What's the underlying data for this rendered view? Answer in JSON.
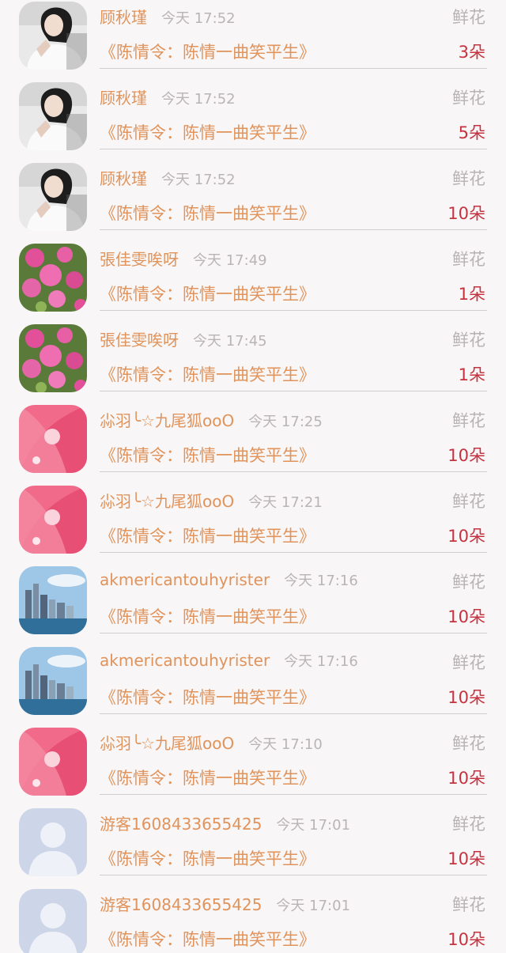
{
  "records": [
    {
      "name": "顾秋瑾",
      "time": "今天 17:52",
      "gift": "鲜花",
      "book": "《陈情令：陈情一曲笑平生》",
      "count": "3朵",
      "avatar": "portrait-girl"
    },
    {
      "name": "顾秋瑾",
      "time": "今天 17:52",
      "gift": "鲜花",
      "book": "《陈情令：陈情一曲笑平生》",
      "count": "5朵",
      "avatar": "portrait-girl"
    },
    {
      "name": "顾秋瑾",
      "time": "今天 17:52",
      "gift": "鲜花",
      "book": "《陈情令：陈情一曲笑平生》",
      "count": "10朵",
      "avatar": "portrait-girl"
    },
    {
      "name": "張佳雯唉呀",
      "time": "今天 17:49",
      "gift": "鲜花",
      "book": "《陈情令：陈情一曲笑平生》",
      "count": "1朵",
      "avatar": "pink-flowers"
    },
    {
      "name": "張佳雯唉呀",
      "time": "今天 17:45",
      "gift": "鲜花",
      "book": "《陈情令：陈情一曲笑平生》",
      "count": "1朵",
      "avatar": "pink-flowers"
    },
    {
      "name": "尛羽╰☆九尾狐ooO",
      "time": "今天 17:25",
      "gift": "鲜花",
      "book": "《陈情令：陈情一曲笑平生》",
      "count": "10朵",
      "avatar": "pink-fox"
    },
    {
      "name": "尛羽╰☆九尾狐ooO",
      "time": "今天 17:21",
      "gift": "鲜花",
      "book": "《陈情令：陈情一曲笑平生》",
      "count": "10朵",
      "avatar": "pink-fox"
    },
    {
      "name": "akmericantouhyrister",
      "time": "今天 17:16",
      "gift": "鲜花",
      "book": "《陈情令：陈情一曲笑平生》",
      "count": "10朵",
      "avatar": "city-skyline"
    },
    {
      "name": "akmericantouhyrister",
      "time": "今天 17:16",
      "gift": "鲜花",
      "book": "《陈情令：陈情一曲笑平生》",
      "count": "10朵",
      "avatar": "city-skyline"
    },
    {
      "name": "尛羽╰☆九尾狐ooO",
      "time": "今天 17:10",
      "gift": "鲜花",
      "book": "《陈情令：陈情一曲笑平生》",
      "count": "10朵",
      "avatar": "pink-fox"
    },
    {
      "name": "游客1608433655425",
      "time": "今天 17:01",
      "gift": "鲜花",
      "book": "《陈情令：陈情一曲笑平生》",
      "count": "10朵",
      "avatar": "default-user"
    },
    {
      "name": "游客1608433655425",
      "time": "今天 17:01",
      "gift": "鲜花",
      "book": "《陈情令：陈情一曲笑平生》",
      "count": "10朵",
      "avatar": "default-user"
    }
  ],
  "colors": {
    "name": "#e0935b",
    "time": "#b9b4b6",
    "count": "#c7323f",
    "background": "#f8f6f7"
  }
}
